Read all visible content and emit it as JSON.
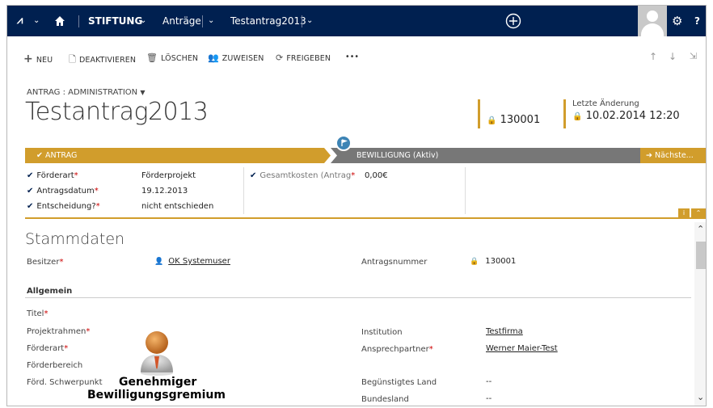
{
  "nav": {
    "area": "STIFTUNG",
    "entity": "Anträge",
    "record": "Testantrag2013",
    "question": "?"
  },
  "commands": {
    "neu": "NEU",
    "deaktivieren": "DEAKTIVIEREN",
    "loeschen": "LÖSCHEN",
    "zuweisen": "ZUWEISEN",
    "freigeben": "FREIGEBEN",
    "more": "•••"
  },
  "header": {
    "form_selector": "ANTRAG : ADMINISTRATION",
    "title": "Testantrag2013",
    "number_value": "130001",
    "modified_label": "Letzte Änderung",
    "modified_value": "10.02.2014  12:20"
  },
  "process": {
    "stage1": "ANTRAG",
    "stage2": "BEWILLIGUNG (Aktiv)",
    "next": "Nächste..."
  },
  "stage_fields": {
    "foerderart_label": "Förderart",
    "foerderart_value": "Förderprojekt",
    "antragsdatum_label": "Antragsdatum",
    "antragsdatum_value": "19.12.2013",
    "entscheidung_label": "Entscheidung?",
    "entscheidung_value": "nicht entschieden",
    "gesamtkosten_label": "Gesamtkosten (Antrag",
    "gesamtkosten_value": "0,00€"
  },
  "form": {
    "section_title": "Stammdaten",
    "besitzer_label": "Besitzer",
    "besitzer_value": "OK Systemuser",
    "antragsnummer_label": "Antragsnummer",
    "antragsnummer_value": "130001",
    "subsection": "Allgemein",
    "titel_label": "Titel",
    "projektrahmen_label": "Projektrahmen",
    "foerderart_label": "Förderart",
    "foerderbereich_label": "Förderbereich",
    "schwerpunkt_label": "Förd. Schwerpunkt",
    "institution_label": "Institution",
    "institution_value": "Testfirma",
    "ansprechpartner_label": "Ansprechpartner",
    "ansprechpartner_value": "Werner Maier-Test",
    "land_label": "Begünstigtes Land",
    "land_value": "--",
    "bundesland_label": "Bundesland",
    "bundesland_value": "--"
  },
  "overlay": {
    "line1": "Genehmiger",
    "line2": "Bewilligungsgremium"
  },
  "colors": {
    "nav_bg": "#002050",
    "accent": "#d19d2c",
    "active_stage": "#777777"
  }
}
